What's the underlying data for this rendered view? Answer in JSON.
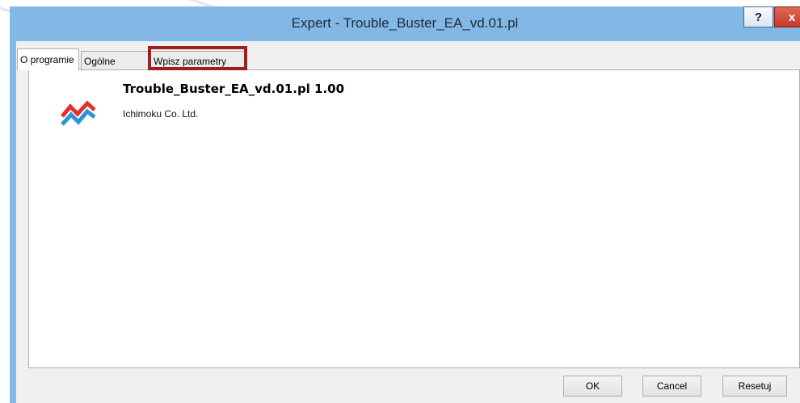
{
  "window": {
    "title": "Expert - Trouble_Buster_EA_vd.01.pl"
  },
  "titlebar": {
    "help_label": "?",
    "close_label": "x"
  },
  "tabs": [
    {
      "label": "O programie",
      "active": true
    },
    {
      "label": "Ogólne",
      "active": false
    },
    {
      "label": "Wpisz parametry",
      "active": false,
      "highlighted": true
    }
  ],
  "about": {
    "program_name": "Trouble_Buster_EA_vd.01.pl 1.00",
    "company": "Ichimoku Co. Ltd.",
    "logo_icon": "trading-chart-icon"
  },
  "buttons": {
    "ok": "OK",
    "cancel": "Cancel",
    "reset": "Resetuj"
  },
  "colors": {
    "frame": "#83b7e6",
    "highlight": "#a01e1e",
    "close": "#c2392a",
    "logo_red": "#e2312b",
    "logo_blue": "#2a95d6"
  }
}
